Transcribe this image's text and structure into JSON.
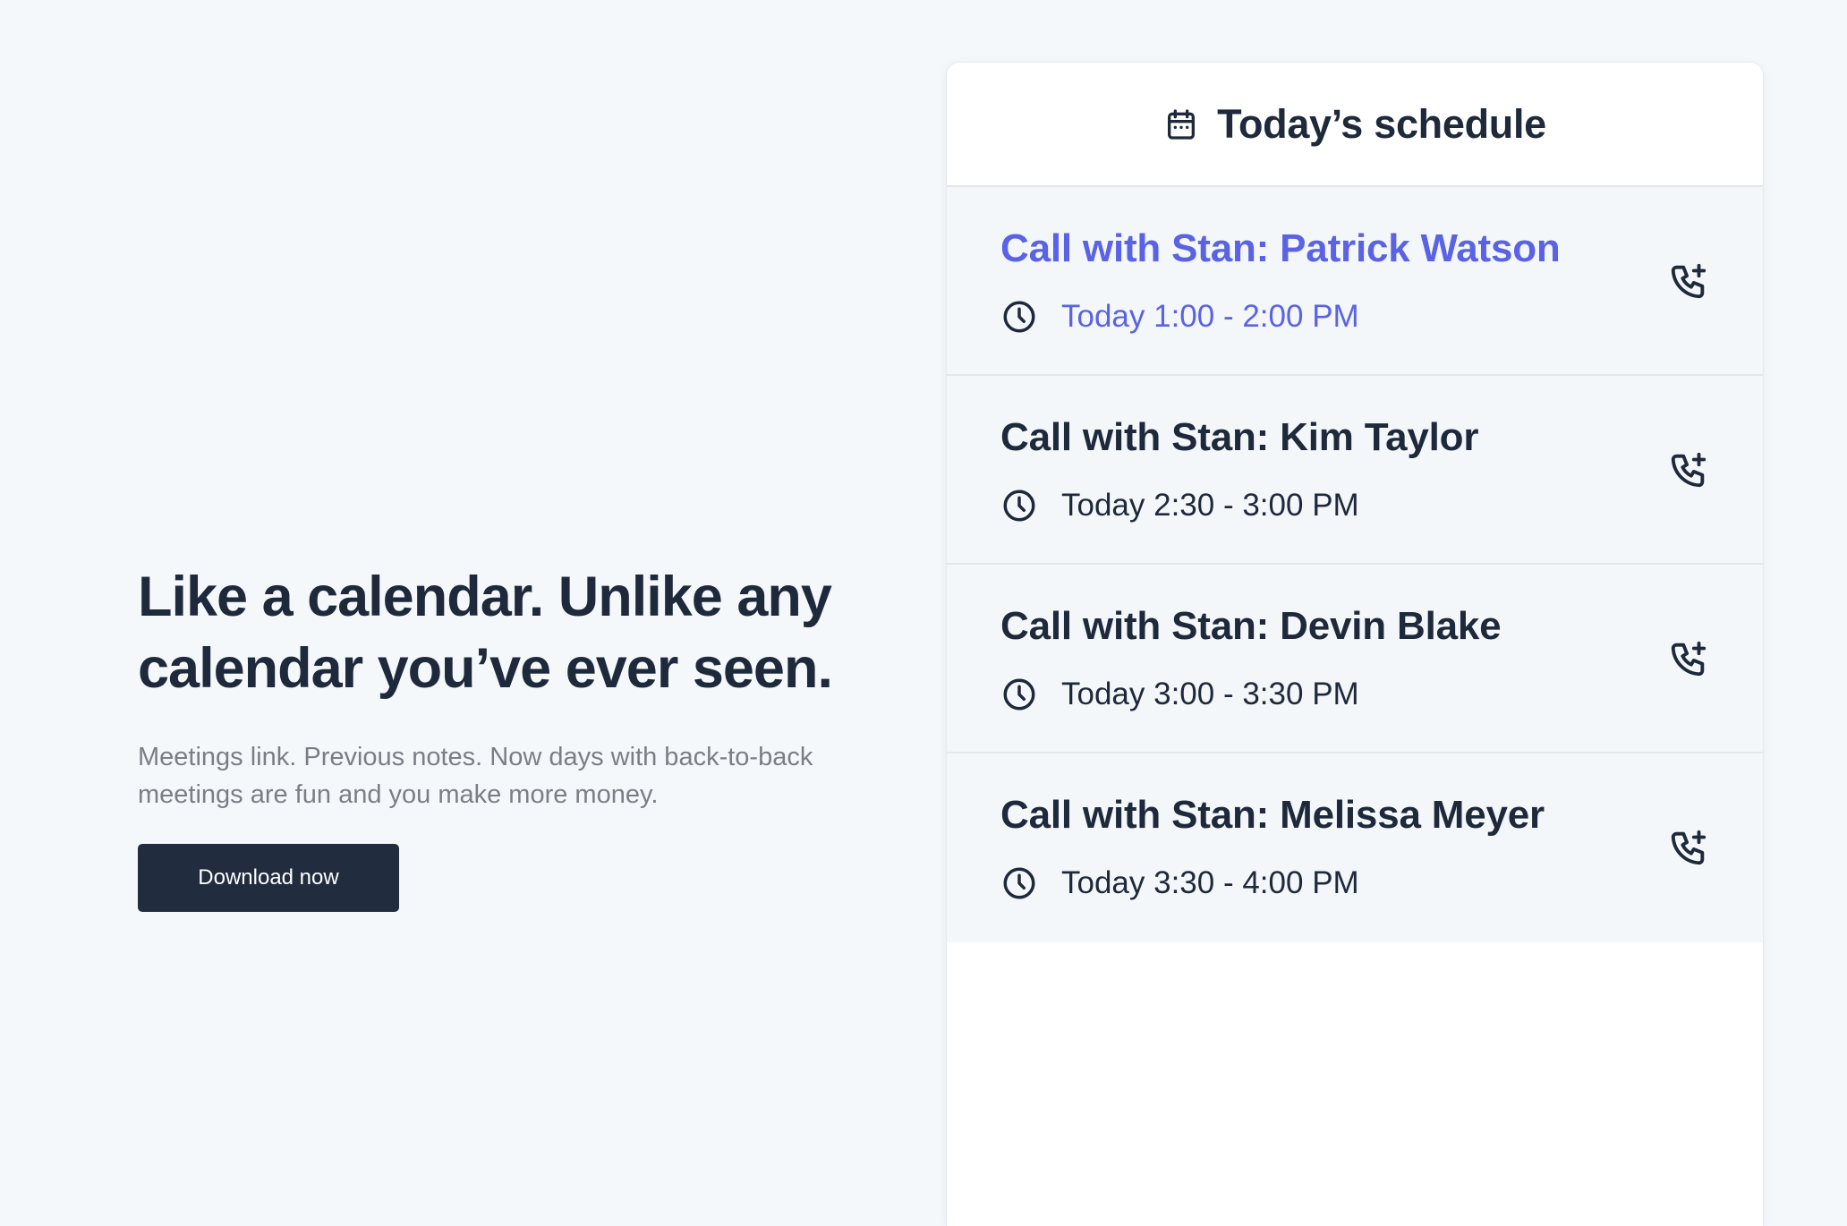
{
  "hero": {
    "title_line1": "Like a calendar. Unlike any",
    "title_line2": "calendar you’ve ever seen.",
    "subtitle": "Meetings link. Previous notes. Now days with back-to-back meetings are fun and you make more money.",
    "button_label": "Download now"
  },
  "schedule": {
    "title": "Today’s schedule",
    "header_icon": "calendar-icon",
    "active_color": "#5a63e6",
    "events": [
      {
        "title": "Call with Stan: Patrick Watson",
        "time": "Today 1:00 - 2:00 PM",
        "active": true
      },
      {
        "title": "Call with Stan: Kim Taylor",
        "time": "Today 2:30 - 3:00 PM",
        "active": false
      },
      {
        "title": "Call with Stan: Devin Blake",
        "time": "Today 3:00 - 3:30 PM",
        "active": false
      },
      {
        "title": "Call with Stan: Melissa Meyer",
        "time": "Today 3:30 - 4:00 PM",
        "active": false
      }
    ],
    "time_icon": "clock-icon",
    "action_icon": "phone-plus-icon"
  }
}
